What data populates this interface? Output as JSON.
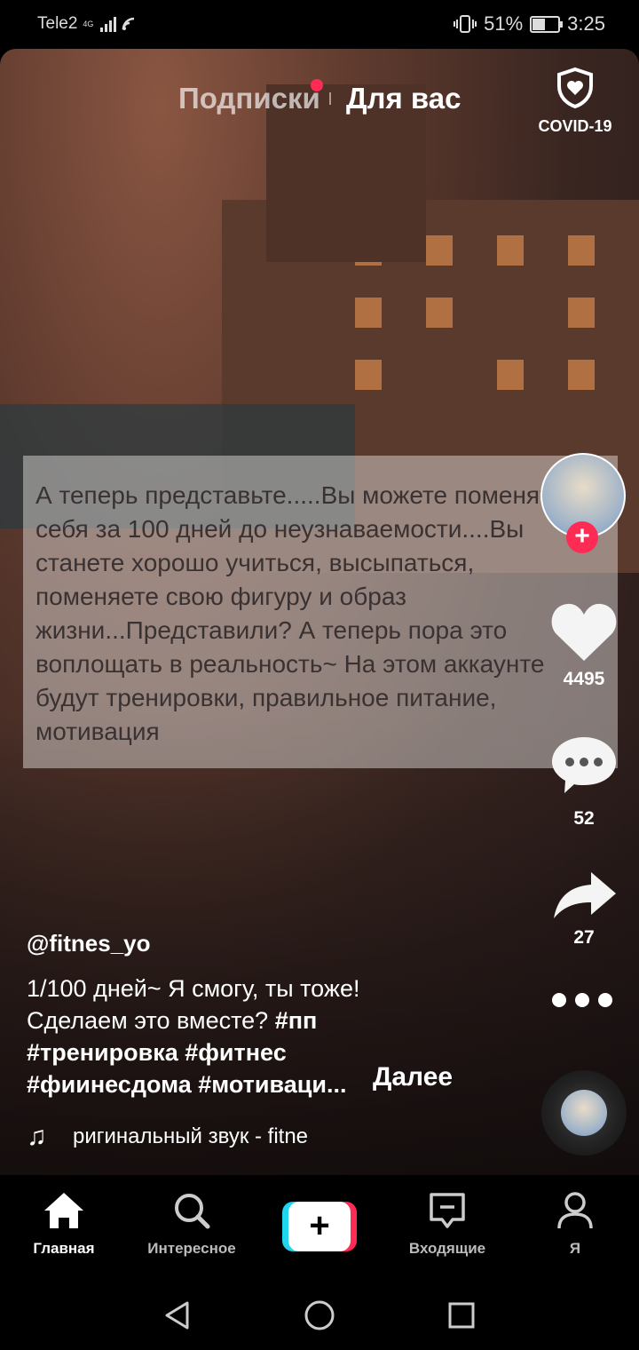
{
  "status_bar": {
    "carrier": "Tele2",
    "network": "4G",
    "battery_percent": "51%",
    "battery_level": 0.51,
    "time": "3:25"
  },
  "top_tabs": {
    "following": "Подписки",
    "for_you": "Для вас",
    "covid": "COVID-19"
  },
  "overlay_text": "А теперь представьте.....Вы можете поменять себя за 100 дней до неузнаваемости....Вы станете хорошо учиться,  высыпаться, поменяете свою фигуру и образ жизни...Представили? А теперь пора это воплощать в реальность~ На этом аккаунте будут тренировки, правильное питание, мотивация",
  "actions": {
    "likes": "4495",
    "comments": "52",
    "shares": "27"
  },
  "post": {
    "username": "@fitnes_yo",
    "caption": "1/100 дней~ Я смогу, ты тоже! Сделаем это вместе?",
    "tags": "#пп #тренировка #фитнес #фиинесдома #мотиваци...",
    "more": "Далее",
    "music": "ригинальный звук - fitne"
  },
  "bottom_nav": {
    "home": "Главная",
    "discover": "Интересное",
    "inbox": "Входящие",
    "me": "Я"
  },
  "colors": {
    "accent": "#fe2c55",
    "cyan": "#20d5ec"
  }
}
